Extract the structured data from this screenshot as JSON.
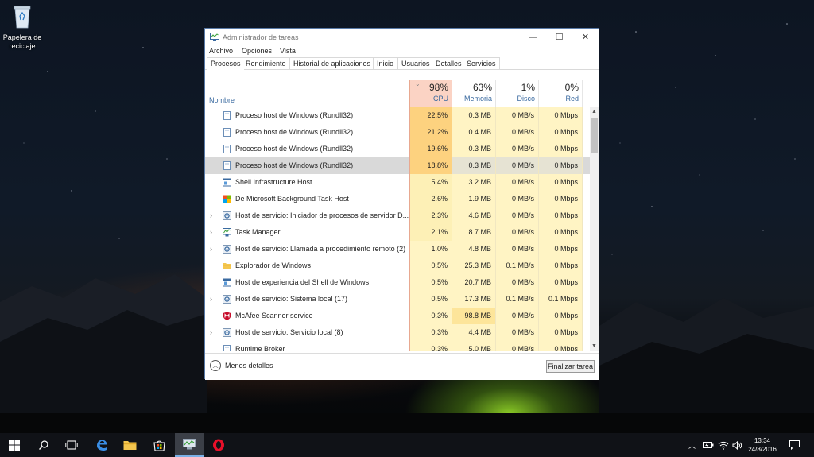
{
  "desktop": {
    "recycle_bin_label_line1": "Papelera de",
    "recycle_bin_label_line2": "reciclaje"
  },
  "window": {
    "title": "Administrador de tareas",
    "controls": {
      "minimize": "—",
      "maximize": "☐",
      "close": "✕"
    }
  },
  "menu": {
    "file": "Archivo",
    "options": "Opciones",
    "view": "Vista"
  },
  "tabs": [
    {
      "label": "Procesos",
      "active": true
    },
    {
      "label": "Rendimiento"
    },
    {
      "label": "Historial de aplicaciones"
    },
    {
      "label": "Inicio"
    },
    {
      "label": "Usuarios"
    },
    {
      "label": "Detalles"
    },
    {
      "label": "Servicios"
    }
  ],
  "columns": {
    "name": "Nombre",
    "cpu": {
      "pct": "98%",
      "label": "CPU"
    },
    "memory": {
      "pct": "63%",
      "label": "Memoria"
    },
    "disk": {
      "pct": "1%",
      "label": "Disco"
    },
    "network": {
      "pct": "0%",
      "label": "Red"
    }
  },
  "processes": [
    {
      "name": "Proceso host de Windows (Rundll32)",
      "cpu": "22.5%",
      "mem": "0.3 MB",
      "disk": "0 MB/s",
      "net": "0 Mbps",
      "icon": "generic-process-icon",
      "expand": false
    },
    {
      "name": "Proceso host de Windows (Rundll32)",
      "cpu": "21.2%",
      "mem": "0.4 MB",
      "disk": "0 MB/s",
      "net": "0 Mbps",
      "icon": "generic-process-icon",
      "expand": false
    },
    {
      "name": "Proceso host de Windows (Rundll32)",
      "cpu": "19.6%",
      "mem": "0.3 MB",
      "disk": "0 MB/s",
      "net": "0 Mbps",
      "icon": "generic-process-icon",
      "expand": false
    },
    {
      "name": "Proceso host de Windows (Rundll32)",
      "cpu": "18.8%",
      "mem": "0.3 MB",
      "disk": "0 MB/s",
      "net": "0 Mbps",
      "icon": "generic-process-icon",
      "expand": false,
      "selected": true
    },
    {
      "name": "Shell Infrastructure Host",
      "cpu": "5.4%",
      "mem": "3.2 MB",
      "disk": "0 MB/s",
      "net": "0 Mbps",
      "icon": "window-app-icon",
      "expand": false
    },
    {
      "name": "De Microsoft Background Task Host",
      "cpu": "2.6%",
      "mem": "1.9 MB",
      "disk": "0 MB/s",
      "net": "0 Mbps",
      "icon": "windows-logo-icon",
      "expand": false
    },
    {
      "name": "Host de servicio: Iniciador de procesos de servidor D...",
      "cpu": "2.3%",
      "mem": "4.6 MB",
      "disk": "0 MB/s",
      "net": "0 Mbps",
      "icon": "service-gear-icon",
      "expand": true
    },
    {
      "name": "Task Manager",
      "cpu": "2.1%",
      "mem": "8.7 MB",
      "disk": "0 MB/s",
      "net": "0 Mbps",
      "icon": "task-manager-icon",
      "expand": true
    },
    {
      "name": "Host de servicio: Llamada a procedimiento remoto (2)",
      "cpu": "1.0%",
      "mem": "4.8 MB",
      "disk": "0 MB/s",
      "net": "0 Mbps",
      "icon": "service-gear-icon",
      "expand": true
    },
    {
      "name": "Explorador de Windows",
      "cpu": "0.5%",
      "mem": "25.3 MB",
      "disk": "0.1 MB/s",
      "net": "0 Mbps",
      "icon": "folder-icon",
      "expand": false
    },
    {
      "name": "Host de experiencia del Shell de Windows",
      "cpu": "0.5%",
      "mem": "20.7 MB",
      "disk": "0 MB/s",
      "net": "0 Mbps",
      "icon": "window-app-icon",
      "expand": false
    },
    {
      "name": "Host de servicio: Sistema local (17)",
      "cpu": "0.5%",
      "mem": "17.3 MB",
      "disk": "0.1 MB/s",
      "net": "0.1 Mbps",
      "icon": "service-gear-icon",
      "expand": true
    },
    {
      "name": "McAfee Scanner service",
      "cpu": "0.3%",
      "mem": "98.8 MB",
      "disk": "0 MB/s",
      "net": "0 Mbps",
      "icon": "mcafee-shield-icon",
      "expand": false
    },
    {
      "name": "Host de servicio: Servicio local (8)",
      "cpu": "0.3%",
      "mem": "4.4 MB",
      "disk": "0 MB/s",
      "net": "0 Mbps",
      "icon": "service-gear-icon",
      "expand": true
    },
    {
      "name": "Runtime Broker",
      "cpu": "0.3%",
      "mem": "5.0 MB",
      "disk": "0 MB/s",
      "net": "0 Mbps",
      "icon": "generic-process-icon",
      "expand": false
    }
  ],
  "footer": {
    "less_details": "Menos detalles",
    "end_task": "Finalizar tarea"
  },
  "taskbar": {
    "time": "13:34",
    "date": "24/8/2016"
  },
  "colors": {
    "cpu_header_bg": "#fbd3c4",
    "cpu_heavy": "#fdd27f",
    "cpu_light": "#fdf0b6",
    "cell_light": "#fff4c4",
    "mem_heavy": "#fde59a",
    "accent_blue": "#3a6aa0"
  }
}
